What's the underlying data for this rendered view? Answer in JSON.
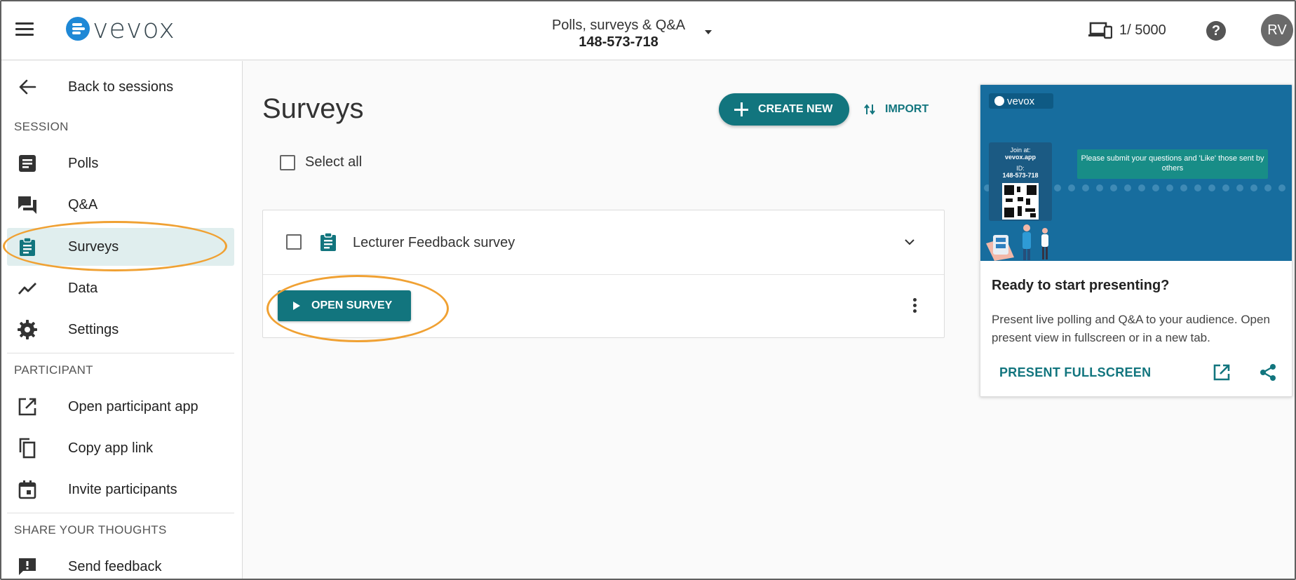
{
  "header": {
    "logo_text": "vevox",
    "session_name": "Polls, surveys & Q&A",
    "session_code": "148-573-718",
    "participants_count": "1/ 5000",
    "help_label": "?",
    "avatar_initials": "RV"
  },
  "sidebar": {
    "back_label": "Back to sessions",
    "sections": {
      "session": "SESSION",
      "participant": "PARTICIPANT",
      "share": "SHARE YOUR THOUGHTS"
    },
    "items": {
      "polls": "Polls",
      "qa": "Q&A",
      "surveys": "Surveys",
      "data": "Data",
      "settings": "Settings",
      "open_app": "Open participant app",
      "copy_link": "Copy app link",
      "invite": "Invite participants",
      "feedback": "Send feedback"
    },
    "active_item": "Surveys"
  },
  "main": {
    "title": "Surveys",
    "create_new_label": "CREATE NEW",
    "import_label": "IMPORT",
    "select_all_label": "Select all",
    "surveys": [
      {
        "name": "Lecturer Feedback survey",
        "open_label": "OPEN SURVEY"
      }
    ]
  },
  "present_panel": {
    "preview": {
      "logo_text": "vevox",
      "join_at": "Join at:",
      "join_url": "vevox.app",
      "id_label": "ID:",
      "id_value": "148-573-718",
      "message": "Please submit your questions and 'Like' those sent by others"
    },
    "heading": "Ready to start presenting?",
    "description": "Present live polling and Q&A to your audience. Open present view in fullscreen or in a new tab.",
    "fullscreen_label": "PRESENT FULLSCREEN"
  },
  "colors": {
    "brand_teal": "#12757e",
    "active_bg": "#e0eeee",
    "highlight_orange": "#f0a133",
    "preview_blue": "#176d9e",
    "logo_blue": "#1e88d6"
  }
}
